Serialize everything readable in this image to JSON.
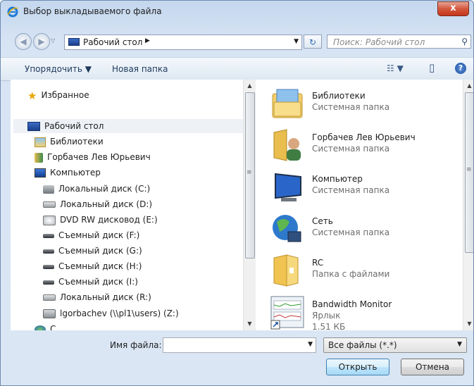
{
  "window": {
    "title": "Выбор выкладываемого файла",
    "close_label": "x"
  },
  "nav": {
    "back_glyph": "◀",
    "forward_glyph": "▶",
    "history_glyph": "▽",
    "address_text": "Рабочий стол",
    "address_chevron": "▶",
    "address_dropdown": "▼",
    "refresh_glyph": "↻",
    "search_placeholder": "Поиск: Рабочий стол",
    "search_glyph": "⚲"
  },
  "toolbar": {
    "organize_label": "Упорядочить ▼",
    "new_folder_label": "Новая папка",
    "views_glyph": "☷ ▼",
    "preview_glyph": "▯",
    "help_glyph": "?"
  },
  "tree": {
    "favorites": "Избранное",
    "desktop": "Рабочий стол",
    "libraries": "Библиотеки",
    "user": "Горбачев Лев Юрьевич",
    "computer": "Компьютер",
    "drives": [
      "Локальный диск (C:)",
      "Локальный диск (D:)",
      "DVD RW дисковод (E:)",
      "Съемный диск (F:)",
      "Съемный диск (G:)",
      "Съемный диск (H:)",
      "Съемный диск (I:)",
      "Локальный диск (R:)",
      "lgorbachev (\\\\pl1\\users) (Z:)"
    ],
    "network_partial": "С"
  },
  "files": [
    {
      "name": "Библиотеки",
      "type": "Системная папка"
    },
    {
      "name": "Горбачев Лев Юрьевич",
      "type": "Системная папка"
    },
    {
      "name": "Компьютер",
      "type": "Системная папка"
    },
    {
      "name": "Сеть",
      "type": "Системная папка"
    },
    {
      "name": "RC",
      "type": "Папка с файлами"
    },
    {
      "name": "Bandwidth Monitor",
      "type": "Ярлык",
      "size": "1.51 КБ"
    }
  ],
  "scroll": {
    "up": "▲",
    "down": "▼",
    "grip": "≡"
  },
  "bottom": {
    "filename_label": "Имя файла:",
    "filename_value": "",
    "filename_dd": "▼",
    "filetype_value": "Все файлы (*.*)",
    "filetype_dd": "▼",
    "open_label": "Открыть",
    "cancel_label": "Отмена"
  }
}
